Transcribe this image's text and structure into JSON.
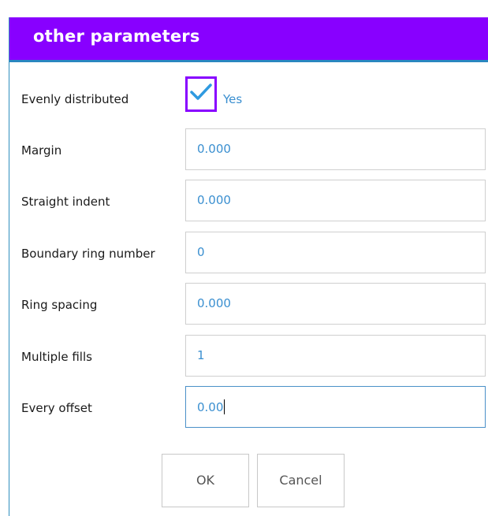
{
  "dialog": {
    "title": "other parameters"
  },
  "evenly_distributed": {
    "label": "Evenly distributed",
    "checked": true,
    "option_label": "Yes"
  },
  "fields": [
    {
      "label": "Margin",
      "value": "0.000"
    },
    {
      "label": "Straight indent",
      "value": "0.000"
    },
    {
      "label": "Boundary ring number",
      "value": "0"
    },
    {
      "label": "Ring spacing",
      "value": "0.000"
    },
    {
      "label": "Multiple fills",
      "value": "1"
    },
    {
      "label": "Every offset",
      "value": "0.00"
    }
  ],
  "buttons": {
    "ok": "OK",
    "cancel": "Cancel"
  },
  "colors": {
    "title_bar": "#8800ff",
    "value_text": "#3a8fd0",
    "checkbox_focus": "#8800ff"
  }
}
